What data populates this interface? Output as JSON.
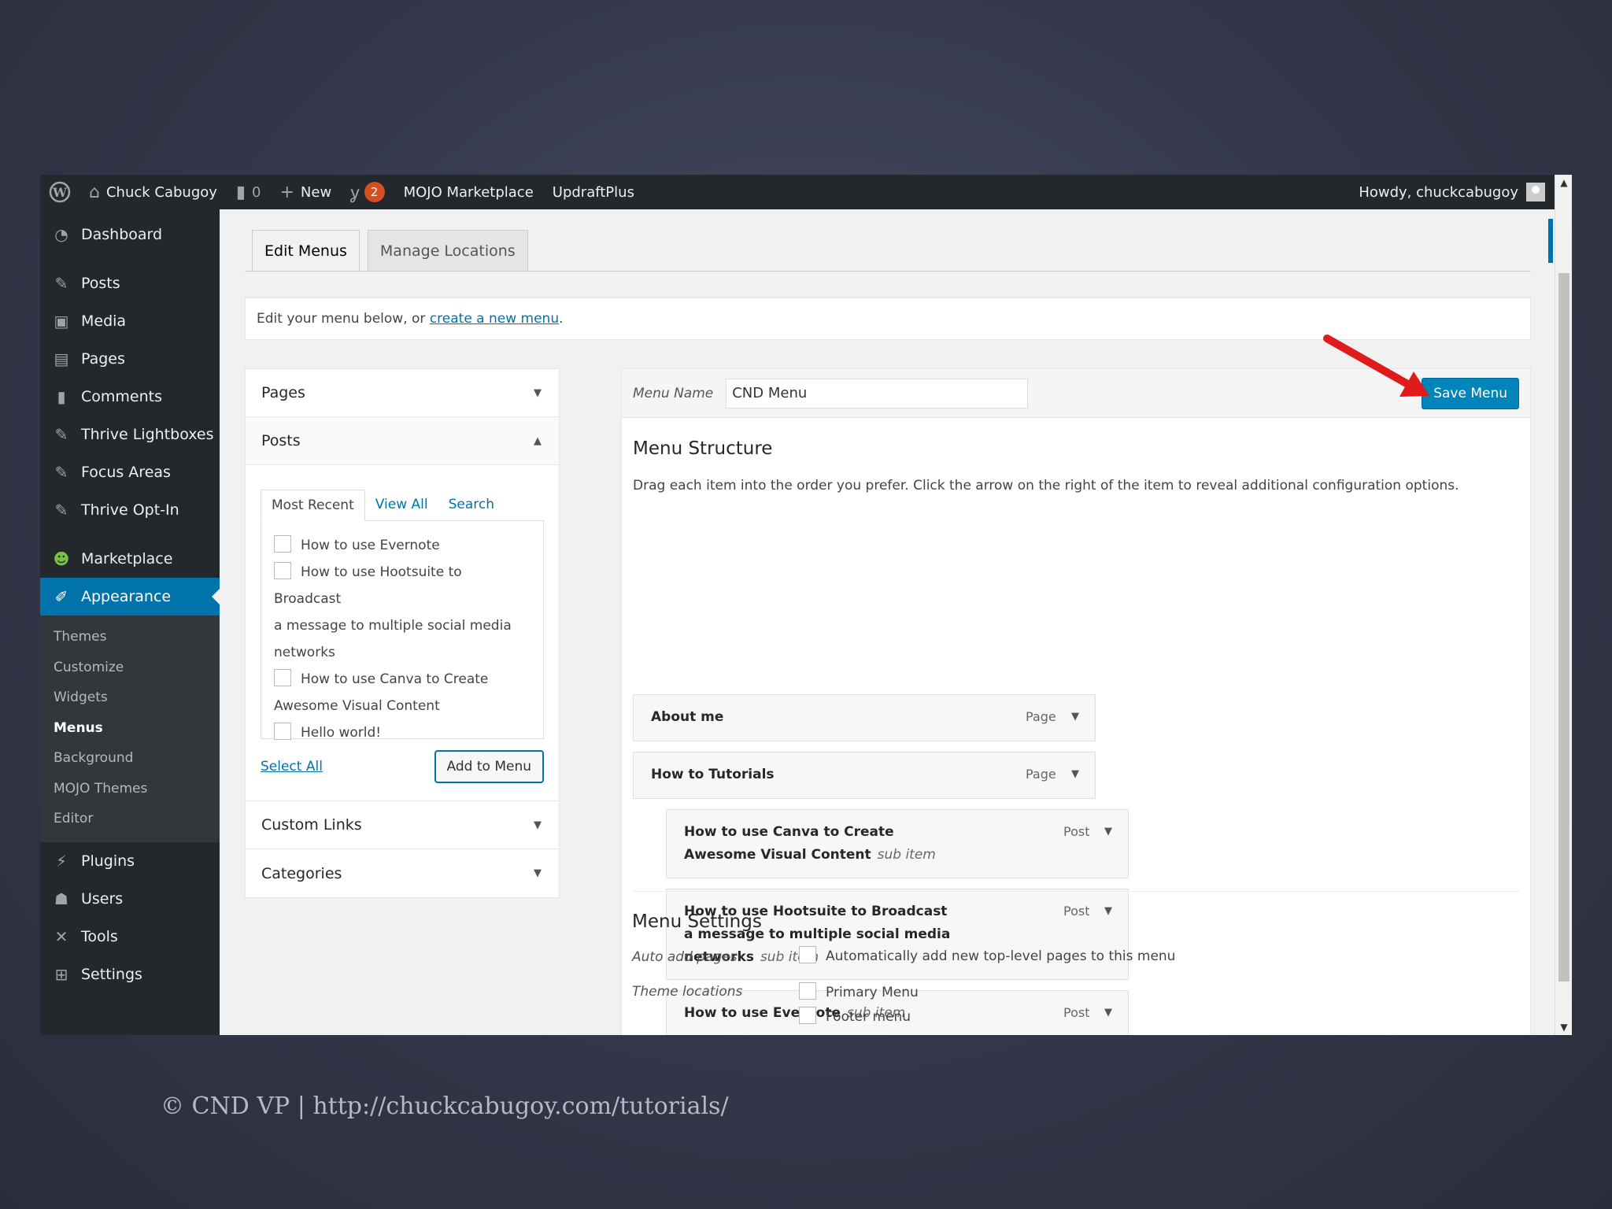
{
  "adminbar": {
    "site_name": "Chuck Cabugoy",
    "comments_count": "0",
    "new_label": "New",
    "yoast_badge": "2",
    "mojo": "MOJO Marketplace",
    "updraft": "UpdraftPlus",
    "howdy": "Howdy, chuckcabugoy"
  },
  "sidebar": {
    "items": [
      {
        "label": "Dashboard",
        "icon": "dashboard-icon"
      },
      {
        "label": "Posts",
        "icon": "pin-icon"
      },
      {
        "label": "Media",
        "icon": "media-icon"
      },
      {
        "label": "Pages",
        "icon": "pages-icon"
      },
      {
        "label": "Comments",
        "icon": "comment-icon"
      },
      {
        "label": "Thrive Lightboxes",
        "icon": "pin-icon"
      },
      {
        "label": "Focus Areas",
        "icon": "pin-icon"
      },
      {
        "label": "Thrive Opt-In",
        "icon": "pin-icon"
      },
      {
        "label": "Marketplace",
        "icon": "mojo-icon"
      },
      {
        "label": "Appearance",
        "icon": "paintbrush-icon"
      },
      {
        "label": "Plugins",
        "icon": "plugin-icon"
      },
      {
        "label": "Users",
        "icon": "users-icon"
      },
      {
        "label": "Tools",
        "icon": "wrench-icon"
      },
      {
        "label": "Settings",
        "icon": "settings-icon"
      }
    ],
    "submenu": [
      "Themes",
      "Customize",
      "Widgets",
      "Menus",
      "Background",
      "MOJO Themes",
      "Editor"
    ]
  },
  "tabs": {
    "edit": "Edit Menus",
    "manage": "Manage Locations"
  },
  "notice": {
    "text": "Edit your menu below, or ",
    "link": "create a new menu",
    "end": "."
  },
  "left_panel": {
    "pages": "Pages",
    "posts": "Posts",
    "subtabs": [
      "Most Recent",
      "View All",
      "Search"
    ],
    "post_items": [
      "How to use Evernote",
      "How to use Hootsuite to Broadcast",
      "a message to multiple social media",
      "networks",
      "How to use Canva to Create",
      "Awesome Visual Content",
      "Hello world!"
    ],
    "select_all": "Select All",
    "add_to_menu": "Add to Menu",
    "custom_links": "Custom Links",
    "categories": "Categories"
  },
  "right_panel": {
    "menu_name_label": "Menu Name",
    "menu_name_value": "CND Menu",
    "save_button": "Save Menu",
    "structure_title": "Menu Structure",
    "structure_desc": "Drag each item into the order you prefer. Click the arrow on the right of the item to reveal additional configuration options.",
    "items": [
      {
        "line1": "About me",
        "line2": "",
        "line3": "",
        "type": "Page",
        "sub": ""
      },
      {
        "line1": "How to Tutorials",
        "line2": "",
        "line3": "",
        "type": "Page",
        "sub": ""
      },
      {
        "line1": "How to use Canva to Create",
        "line2": "Awesome Visual Content",
        "line3": "",
        "type": "Post",
        "sub": "sub item"
      },
      {
        "line1": "How to use Hootsuite to Broadcast",
        "line2": "a message to multiple social media",
        "line3": "networks",
        "type": "Post",
        "sub": "sub item"
      },
      {
        "line1": "How to use Evernote",
        "line2": "",
        "line3": "",
        "type": "Post",
        "sub": "sub item"
      }
    ],
    "settings_title": "Menu Settings",
    "auto_add_label": "Auto add pages",
    "auto_add_option": "Automatically add new top-level pages to this menu",
    "theme_locations_label": "Theme locations",
    "locations": [
      "Primary Menu",
      "Footer menu"
    ]
  },
  "footer": "© CND VP | http://chuckcabugoy.com/tutorials/"
}
